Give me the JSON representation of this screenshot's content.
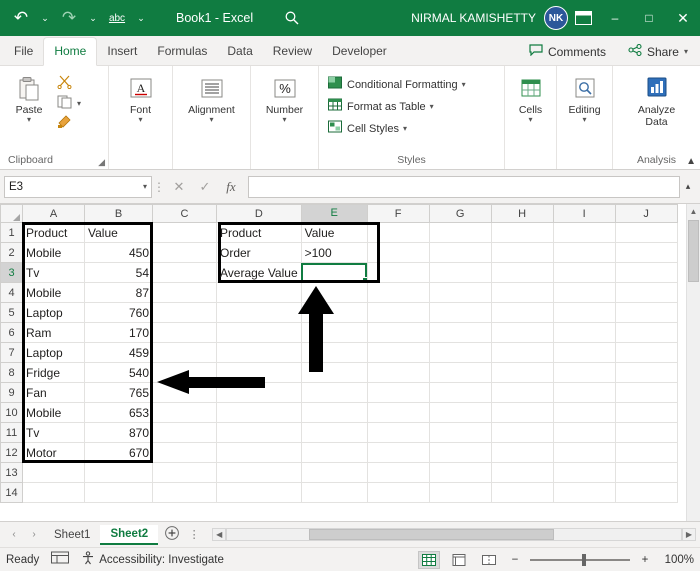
{
  "window": {
    "document_title": "Book1  -  Excel",
    "account_name": "NIRMAL KAMISHETTY",
    "account_initials": "NK",
    "accent_color": "#107c41",
    "quick_access": [
      {
        "name": "undo",
        "glyph": "↶"
      },
      {
        "name": "undo-dropdown",
        "glyph": "⌄"
      },
      {
        "name": "redo",
        "glyph": "↷"
      },
      {
        "name": "redo-dropdown",
        "glyph": "⌄"
      },
      {
        "name": "spelling",
        "glyph": "abc"
      },
      {
        "name": "customize-qat",
        "glyph": "⌄"
      }
    ],
    "controls": [
      {
        "name": "ribbon-display-options",
        "glyph": "▣"
      },
      {
        "name": "minimize",
        "glyph": "–"
      },
      {
        "name": "maximize",
        "glyph": "□"
      },
      {
        "name": "close",
        "glyph": "✕"
      }
    ]
  },
  "tabs": {
    "items": [
      {
        "label": "File",
        "active": false
      },
      {
        "label": "Home",
        "active": true
      },
      {
        "label": "Insert",
        "active": false
      },
      {
        "label": "Formulas",
        "active": false
      },
      {
        "label": "Data",
        "active": false
      },
      {
        "label": "Review",
        "active": false
      },
      {
        "label": "Developer",
        "active": false
      }
    ],
    "comments_label": "Comments",
    "share_label": "Share"
  },
  "ribbon": {
    "groups": [
      {
        "label": "Clipboard",
        "buttons": [
          {
            "name": "paste-button",
            "label": "Paste",
            "glyph": "📋"
          },
          {
            "name": "cut-button",
            "label": "",
            "glyph": "✂"
          },
          {
            "name": "copy-button",
            "label": "",
            "glyph": "⧉"
          },
          {
            "name": "format-painter-button",
            "label": "",
            "glyph": "🖌"
          }
        ]
      },
      {
        "label": "",
        "buttons": [
          {
            "name": "font-group-button",
            "label": "Font",
            "glyph": "A"
          }
        ]
      },
      {
        "label": "",
        "buttons": [
          {
            "name": "alignment-group-button",
            "label": "Alignment",
            "glyph": "≡"
          }
        ]
      },
      {
        "label": "",
        "buttons": [
          {
            "name": "number-group-button",
            "label": "Number",
            "glyph": "%"
          }
        ]
      },
      {
        "label": "Styles",
        "items": [
          {
            "name": "conditional-formatting-button",
            "label": "Conditional Formatting"
          },
          {
            "name": "format-as-table-button",
            "label": "Format as Table"
          },
          {
            "name": "cell-styles-button",
            "label": "Cell Styles"
          }
        ]
      },
      {
        "label": "",
        "buttons": [
          {
            "name": "cells-group-button",
            "label": "Cells",
            "glyph": "▦"
          }
        ]
      },
      {
        "label": "",
        "buttons": [
          {
            "name": "editing-group-button",
            "label": "Editing",
            "glyph": "🔍"
          }
        ]
      },
      {
        "label": "Analysis",
        "buttons": [
          {
            "name": "analyze-data-button",
            "label": "Analyze Data",
            "glyph": "📊"
          }
        ]
      }
    ]
  },
  "formula_bar": {
    "name_box_value": "E3",
    "cancel_glyph": "✕",
    "enter_glyph": "✓",
    "fx_label": "fx",
    "formula_value": ""
  },
  "grid": {
    "columns": [
      "A",
      "B",
      "C",
      "D",
      "E",
      "F",
      "G",
      "H",
      "I",
      "J"
    ],
    "selected_column": "E",
    "selected_row": 3,
    "rows": [
      1,
      2,
      3,
      4,
      5,
      6,
      7,
      8,
      9,
      10,
      11,
      12,
      13,
      14
    ],
    "cells": {
      "A1": "Product",
      "B1": "Value",
      "D1": "Product",
      "E1": "Value",
      "A2": "Mobile",
      "B2": "450",
      "D2": "Order",
      "E2": ">100",
      "A3": "Tv",
      "B3": "54",
      "D3": "Average Value",
      "A4": "Mobile",
      "B4": "87",
      "A5": "Laptop",
      "B5": "760",
      "A6": "Ram",
      "B6": "170",
      "A7": "Laptop",
      "B7": "459",
      "A8": "Fridge",
      "B8": "540",
      "A9": "Fan",
      "B9": "765",
      "A10": "Mobile",
      "B10": "653",
      "A11": "Tv",
      "B11": "870",
      "A12": "Motor",
      "B12": "670"
    },
    "annotations": [
      {
        "name": "highlight-box-data-range",
        "type": "rect"
      },
      {
        "name": "highlight-box-criteria-range",
        "type": "rect"
      },
      {
        "name": "arrow-up-annotation",
        "type": "arrow-up"
      },
      {
        "name": "arrow-left-annotation",
        "type": "arrow-left"
      }
    ]
  },
  "sheet_bar": {
    "sheets": [
      {
        "label": "Sheet1",
        "active": false
      },
      {
        "label": "Sheet2",
        "active": true
      }
    ],
    "add_sheet_glyph": "+",
    "prev_glyph": "‹",
    "next_glyph": "›"
  },
  "status_bar": {
    "status": "Ready",
    "accessibility": "Accessibility: Investigate",
    "zoom_label": "100%",
    "views": [
      {
        "name": "normal-view-button",
        "glyph": "▦",
        "selected": true
      },
      {
        "name": "page-layout-view-button",
        "glyph": "▤",
        "selected": false
      },
      {
        "name": "page-break-view-button",
        "glyph": "▥",
        "selected": false
      }
    ],
    "zoom_out_glyph": "−",
    "zoom_in_glyph": "+"
  }
}
